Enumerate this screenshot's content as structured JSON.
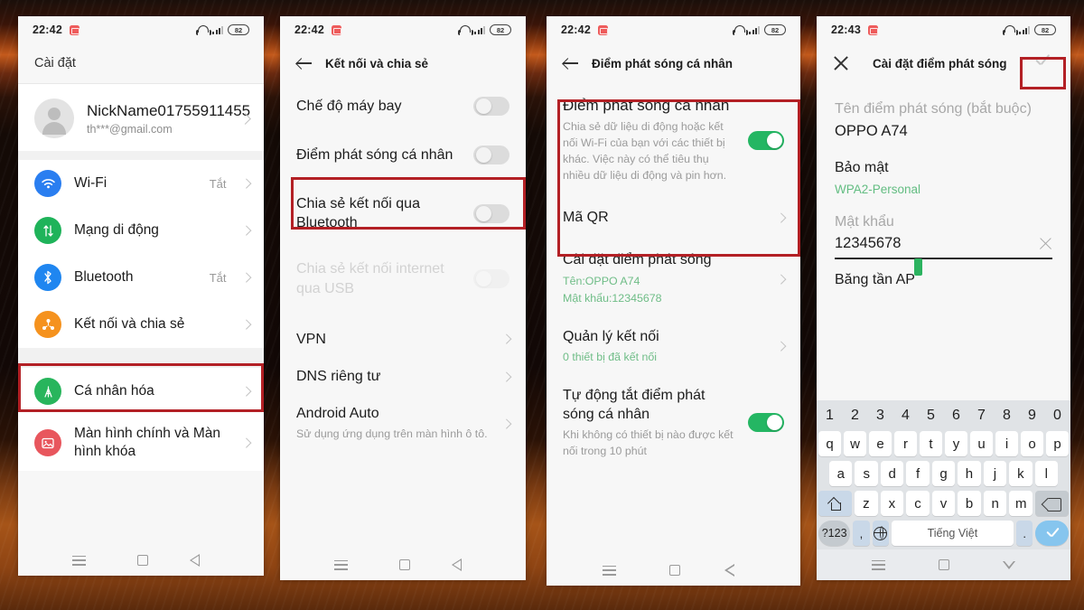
{
  "status_bar": {
    "time_1": "22:42",
    "time_2": "22:42",
    "time_3": "22:42",
    "time_4": "22:43",
    "battery": "82",
    "icons": [
      "headphone-icon",
      "signal-icon",
      "battery-icon"
    ]
  },
  "panel1": {
    "title": "Cài đặt",
    "account": {
      "name": "NickName01755911455",
      "email": "th***@gmail.com"
    },
    "items": [
      {
        "label": "Wi-Fi",
        "value": "Tắt",
        "icon": "wifi-icon",
        "color": "#2a7ef0"
      },
      {
        "label": "Mạng di động",
        "value": "",
        "icon": "mobile-network-icon",
        "color": "#1fb35a"
      },
      {
        "label": "Bluetooth",
        "value": "Tắt",
        "icon": "bluetooth-icon",
        "color": "#1f86f0"
      },
      {
        "label": "Kết nối và chia sẻ",
        "value": "",
        "icon": "connection-share-icon",
        "color": "#f5921e"
      }
    ],
    "items2": [
      {
        "label": "Cá nhân hóa",
        "value": "",
        "icon": "personalization-icon",
        "color": "#28b55c"
      },
      {
        "label": "Màn hình chính và Màn hình khóa",
        "value": "",
        "icon": "home-lock-screen-icon",
        "color": "#e8565d"
      }
    ]
  },
  "panel2": {
    "title": "Kết nối và chia sẻ",
    "rows": [
      {
        "title": "Chế độ máy bay",
        "sub": "",
        "toggle": "off",
        "type": "toggle"
      },
      {
        "title": "Điểm phát sóng cá nhân",
        "sub": "",
        "toggle": "off",
        "type": "toggle"
      },
      {
        "title": "Chia sẻ kết nối qua Bluetooth",
        "sub": "",
        "toggle": "off",
        "type": "toggle"
      },
      {
        "title": "Chia sẻ kết nối internet qua USB",
        "sub": "",
        "toggle": "off",
        "type": "toggle-disabled"
      },
      {
        "title": "VPN",
        "sub": "",
        "type": "chevron"
      },
      {
        "title": "DNS riêng tư",
        "sub": "",
        "type": "chevron"
      },
      {
        "title": "Android Auto",
        "sub": "Sử dụng ứng dụng trên màn hình ô tô.",
        "type": "chevron"
      }
    ]
  },
  "panel3": {
    "title": "Điểm phát sóng cá nhân",
    "hotspot": {
      "title": "Điểm phát sóng cá nhân",
      "sub": "Chia sẻ dữ liệu di động hoặc kết nối Wi-Fi của bạn với các thiết bị khác. Việc này có thể tiêu thụ nhiều dữ liệu di động và pin hơn.",
      "toggle": "on"
    },
    "qr": {
      "title": "Mã QR"
    },
    "hotspot_settings": {
      "title": "Cài đặt điểm phát sóng",
      "sub1": "Tên:OPPO A74",
      "sub2": "Mật khẩu:12345678"
    },
    "manage": {
      "title": "Quản lý kết nối",
      "sub": "0 thiết bị đã kết nối"
    },
    "auto_off": {
      "title": "Tự động tắt điểm phát sóng cá nhân",
      "sub": "Khi không có thiết bị nào được kết nối trong 10 phút",
      "toggle": "on"
    }
  },
  "panel4": {
    "title": "Cài đặt điểm phát sóng",
    "close_icon": "close-icon",
    "confirm_icon": "check-icon",
    "fields": {
      "name_label": "Tên điểm phát sóng (bắt buộc)",
      "name_value": "OPPO A74",
      "security_label": "Bảo mật",
      "security_value": "WPA2-Personal",
      "password_label": "Mật khẩu",
      "password_value": "12345678",
      "band_label": "Băng tần AP"
    },
    "keyboard": {
      "row_num": [
        "1",
        "2",
        "3",
        "4",
        "5",
        "6",
        "7",
        "8",
        "9",
        "0"
      ],
      "row1": [
        "q",
        "w",
        "e",
        "r",
        "t",
        "y",
        "u",
        "i",
        "o",
        "p"
      ],
      "row2": [
        "a",
        "s",
        "d",
        "f",
        "g",
        "h",
        "j",
        "k",
        "l"
      ],
      "row3": [
        "z",
        "x",
        "c",
        "v",
        "b",
        "n",
        "m"
      ],
      "shift_key": "shift-icon",
      "delete_key": "backspace-icon",
      "symbols_key": "?123",
      "comma_key": ",",
      "globe_key": "globe-icon",
      "space_key": "Tiếng Việt",
      "period_key": ".",
      "enter_key": "check-icon"
    }
  },
  "navbar": {
    "menu": "menu-icon",
    "home": "home-icon",
    "back": "back-icon",
    "down": "hide-keyboard-icon"
  },
  "annotations": {
    "highlight_color": "#b32025",
    "boxes": [
      "panel1-connection-share",
      "panel2-personal-hotspot",
      "panel3-personal-hotspot-card",
      "panel4-confirm-check"
    ]
  }
}
